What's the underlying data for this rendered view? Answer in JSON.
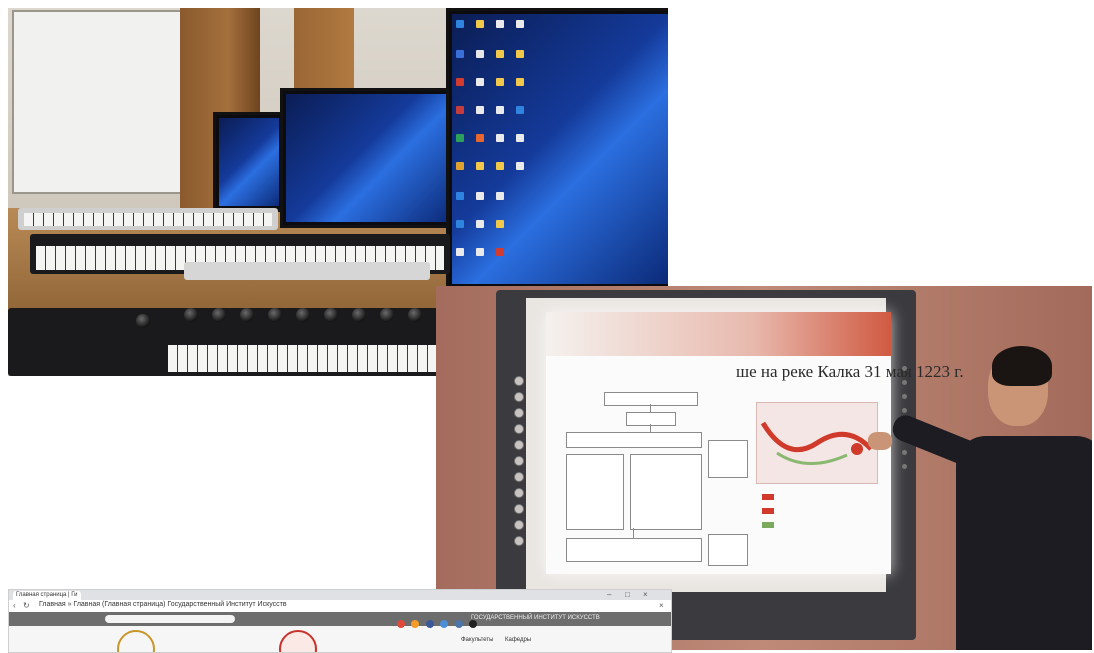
{
  "photos": [
    {
      "name": "computer-music-lab-photo"
    },
    {
      "name": "interactive-whiteboard-lesson-photo"
    },
    {
      "name": "university-website-screenshot-photo"
    }
  ],
  "slide": {
    "title": "ше на реке Калка 31 мая 1223 г."
  },
  "browser": {
    "tab_label": "Главная страница | Ги",
    "address_text": "Главная » Главная (Главная страница) Государственный Институт Искусств",
    "close_glyph": "×",
    "nav_text": "ГОСУДАРСТВЕННЫЙ ИНСТИТУТ ИСКУССТВ",
    "col1": "Факультеты",
    "col2": "Кафедры"
  }
}
